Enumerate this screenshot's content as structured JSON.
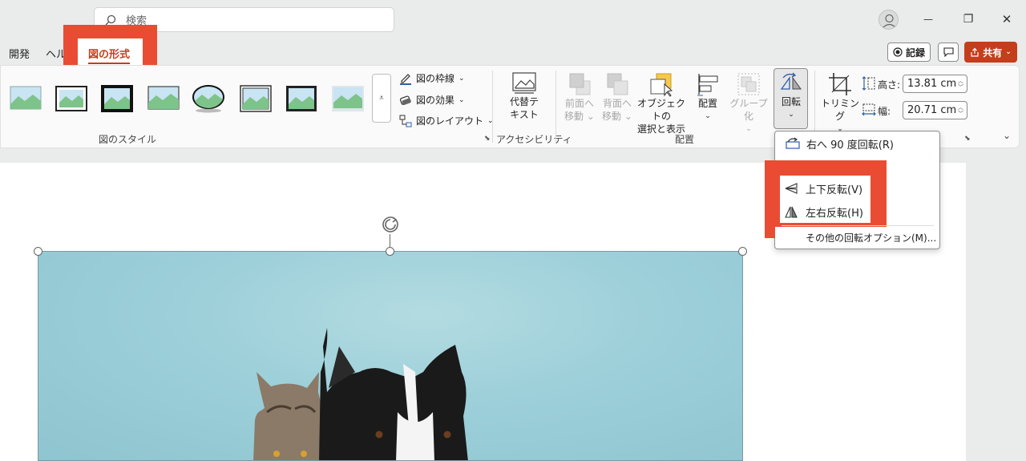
{
  "titlebar": {
    "search_placeholder": "検索",
    "window_controls": {
      "minimize": "—",
      "restore": "❐",
      "close": "✕"
    }
  },
  "tabs": {
    "developer": "開発",
    "help_partial": "ヘル",
    "picture_format": "図の形式"
  },
  "actions": {
    "record": "記録",
    "share": "共有"
  },
  "ribbon": {
    "styles_group_label": "図のスタイル",
    "picture_border": "図の枠線",
    "picture_effects": "図の効果",
    "picture_layout": "図のレイアウト",
    "alt_text": [
      "代替テ",
      "キスト"
    ],
    "accessibility_label": "アクセシビリティ",
    "bring_forward": [
      "前面へ",
      "移動"
    ],
    "send_backward": [
      "背面へ",
      "移動"
    ],
    "selection_pane": [
      "オブジェクトの",
      "選択と表示"
    ],
    "align": "配置",
    "group": "グループ化",
    "rotate": "回転",
    "arrange_label": "配置",
    "crop": "トリミング",
    "height_label": "高さ:",
    "height_value": "13.81 cm",
    "width_label": "幅:",
    "width_value": "20.71 cm"
  },
  "rotate_menu": {
    "rotate_right": "右へ 90 度回転(R)",
    "flip_vertical": "上下反転(V)",
    "flip_horizontal": "左右反転(H)",
    "more_options": "その他の回転オプション(M)..."
  },
  "colors": {
    "accent": "#c43e1c",
    "highlight": "#e94c33",
    "photo_bg": "#9ccfd9"
  },
  "icons": [
    "search-icon",
    "avatar-icon",
    "record-icon",
    "comment-icon",
    "share-icon",
    "rotate-icon",
    "flip-vertical-icon",
    "flip-horizontal-icon",
    "crop-icon",
    "alt-text-icon"
  ]
}
